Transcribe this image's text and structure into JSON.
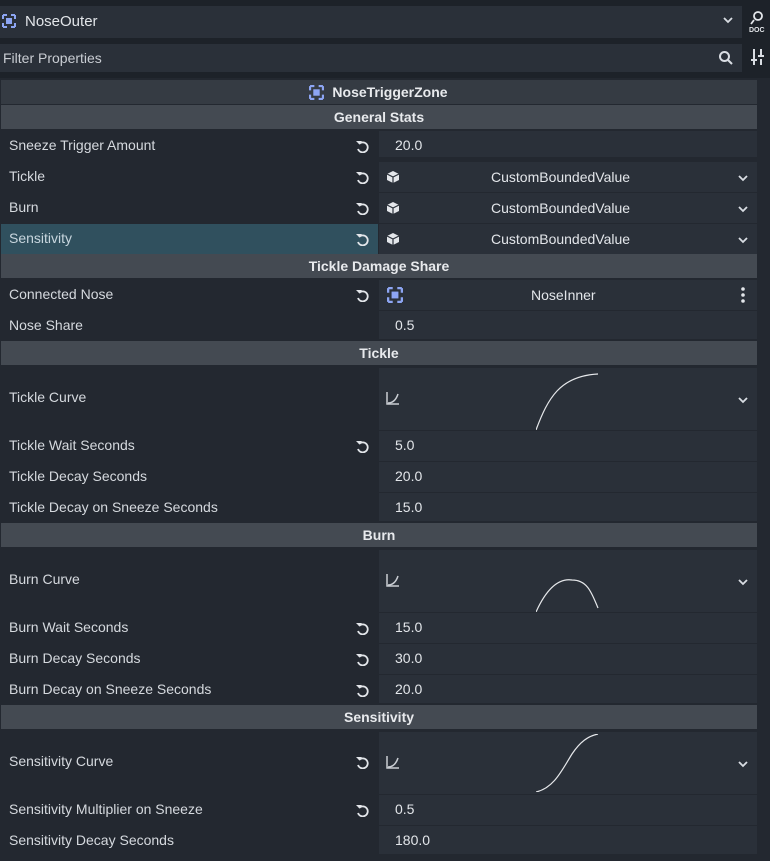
{
  "topbar": {
    "object_name": "NoseOuter",
    "filter_placeholder": "Filter Properties"
  },
  "inspector": {
    "node_title": "NoseTriggerZone",
    "sections": {
      "general": "General Stats",
      "tickle_damage": "Tickle Damage Share",
      "tickle": "Tickle",
      "burn": "Burn",
      "sensitivity": "Sensitivity"
    },
    "rows": {
      "sneeze_trigger": {
        "label": "Sneeze Trigger Amount",
        "value": "20.0"
      },
      "tickle": {
        "label": "Tickle",
        "value": "CustomBoundedValue"
      },
      "burn": {
        "label": "Burn",
        "value": "CustomBoundedValue"
      },
      "sensitivity": {
        "label": "Sensitivity",
        "value": "CustomBoundedValue"
      },
      "connected_nose": {
        "label": "Connected Nose",
        "value": "NoseInner"
      },
      "nose_share": {
        "label": "Nose Share",
        "value": "0.5"
      },
      "tickle_curve": {
        "label": "Tickle Curve"
      },
      "tickle_wait": {
        "label": "Tickle Wait Seconds",
        "value": "5.0"
      },
      "tickle_decay": {
        "label": "Tickle Decay Seconds",
        "value": "20.0"
      },
      "tickle_decay_sneeze": {
        "label": "Tickle Decay on Sneeze Seconds",
        "value": "15.0"
      },
      "burn_curve": {
        "label": "Burn Curve"
      },
      "burn_wait": {
        "label": "Burn Wait Seconds",
        "value": "15.0"
      },
      "burn_decay": {
        "label": "Burn Decay Seconds",
        "value": "30.0"
      },
      "burn_decay_sneeze": {
        "label": "Burn Decay on Sneeze Seconds",
        "value": "20.0"
      },
      "sens_curve": {
        "label": "Sensitivity Curve"
      },
      "sens_mult": {
        "label": "Sensitivity Multiplier on Sneeze",
        "value": "0.5"
      },
      "sens_decay": {
        "label": "Sensitivity Decay Seconds",
        "value": "180.0"
      }
    }
  },
  "colors": {
    "accent_node": "#8da5f3",
    "selected_row": "#30505e",
    "header_bg": "#444a52",
    "field_bg": "#2a3039"
  },
  "icons": [
    "area-node-icon",
    "dropdown-chevron-icon",
    "doc-icon",
    "search-icon",
    "tools-icon",
    "revert-icon",
    "resource-box-icon",
    "curve-icon",
    "kebab-menu-icon"
  ]
}
